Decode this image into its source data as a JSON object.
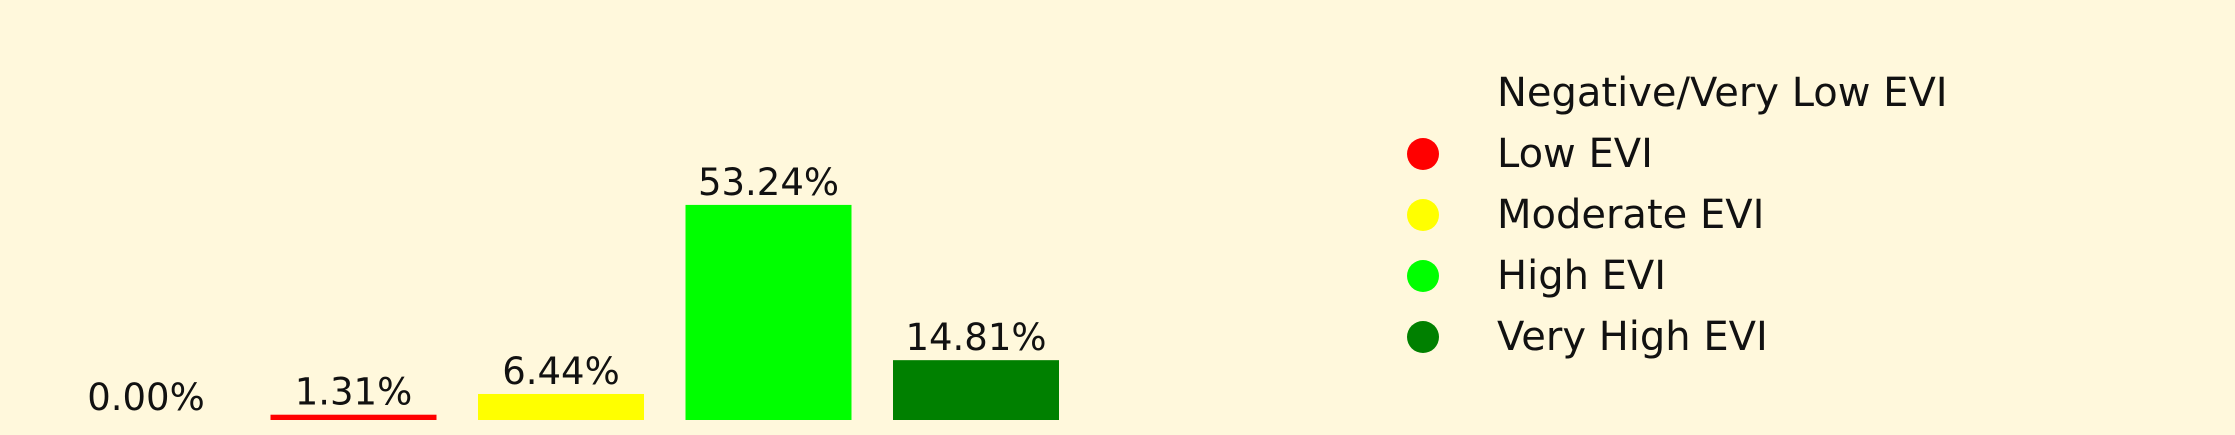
{
  "chart_data": {
    "type": "bar",
    "categories": [
      "Negative/Very Low EVI",
      "Low EVI",
      "Moderate EVI",
      "High EVI",
      "Very High EVI"
    ],
    "values": [
      0.0,
      1.31,
      6.44,
      53.24,
      14.81
    ],
    "value_labels": [
      "0.00%",
      "1.31%",
      "6.44%",
      "53.24%",
      "14.81%"
    ],
    "colors": [
      "#fff8dc",
      "#ff0000",
      "#ffff00",
      "#00ff00",
      "#008000"
    ],
    "ylim": [
      0,
      60
    ],
    "grid": false,
    "legend_position": "right"
  },
  "legend": {
    "items": [
      {
        "label": "Negative/Very Low EVI",
        "color": "#fff8dc"
      },
      {
        "label": "Low EVI",
        "color": "#ff0000"
      },
      {
        "label": "Moderate EVI",
        "color": "#ffff00"
      },
      {
        "label": "High EVI",
        "color": "#00ff00"
      },
      {
        "label": "Very High EVI",
        "color": "#008000"
      }
    ]
  }
}
